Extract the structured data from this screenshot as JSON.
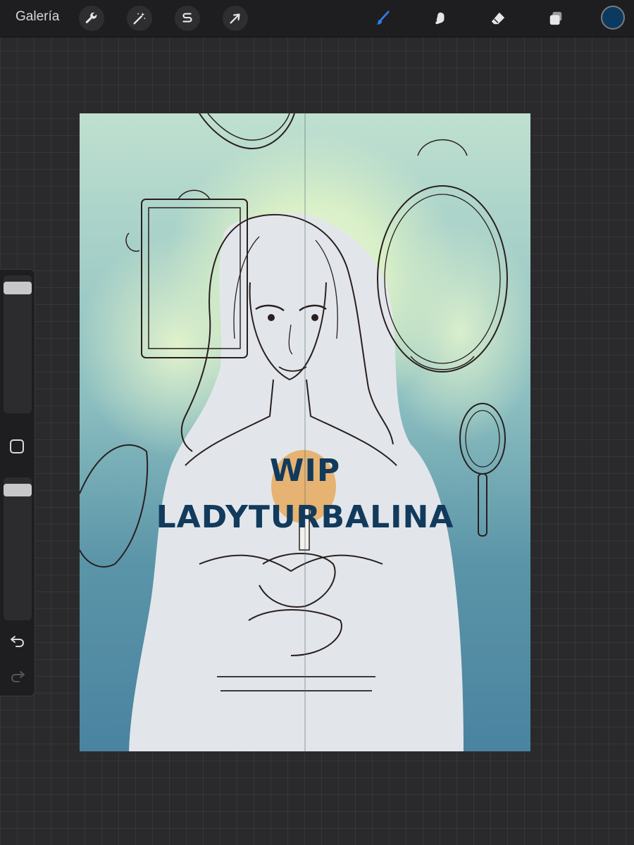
{
  "app": {
    "gallery_label": "Galería"
  },
  "toolbar": {
    "left_tools": [
      {
        "name": "actions",
        "icon": "wrench-icon"
      },
      {
        "name": "adjustments",
        "icon": "magic-wand-icon"
      },
      {
        "name": "selection",
        "icon": "selection-s-icon"
      },
      {
        "name": "transform",
        "icon": "arrow-cursor-icon"
      }
    ],
    "right_tools": [
      {
        "name": "brush",
        "icon": "brush-icon",
        "active": true
      },
      {
        "name": "smudge",
        "icon": "smudge-finger-icon"
      },
      {
        "name": "eraser",
        "icon": "eraser-icon"
      },
      {
        "name": "layers",
        "icon": "layers-icon"
      }
    ],
    "current_color": "#0b3a60",
    "active_tool_color": "#2f7fe8"
  },
  "sidebar": {
    "brush_size_level": 0.95,
    "opacity_level": 0.95,
    "modify_icon": "square-outline-icon",
    "undo_icon": "undo-arrow-icon",
    "redo_icon": "redo-arrow-icon"
  },
  "canvas": {
    "watermark_line1": "WIP",
    "watermark_line2": "LADYTURBALINA",
    "watermark_color": "#123a5c"
  }
}
